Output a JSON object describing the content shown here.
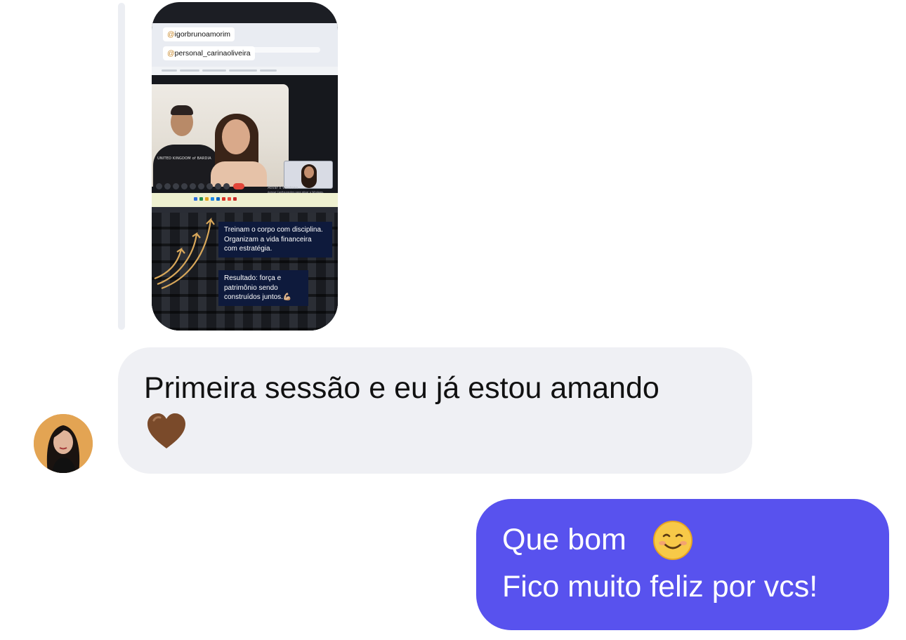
{
  "story": {
    "tag_1": "igorbrunoamorim",
    "tag_2": "personal_carinaoliveira",
    "tag_prefix": "@",
    "shirt_text": "UNITED KINGDOM of BARDIA",
    "windows_notice_line1": "Ativar o Windows",
    "windows_notice_line2": "Acesse Configurações para ativar o Windows.",
    "caption_1": "Treinam o corpo com disciplina. Organizam a vida financeira com estratégia.",
    "caption_2": "Resultado: força e patrimônio sendo construídos juntos.💪🏼"
  },
  "messages": {
    "incoming": {
      "text": "Primeira sessão e eu já estou amando",
      "emoji_name": "brown-heart-icon"
    },
    "outgoing": {
      "line_1": "Que bom",
      "emoji_name": "smiling-face-icon",
      "line_2": "Fico muito feliz por vcs!"
    }
  },
  "colors": {
    "outgoing_bubble": "#5852ee",
    "incoming_bubble": "#eff0f4",
    "caption_bg": "#0e1a3c",
    "tag_at": "#c8882a",
    "heart": "#7a4a2a",
    "avatar_bg": "#e3a453"
  }
}
